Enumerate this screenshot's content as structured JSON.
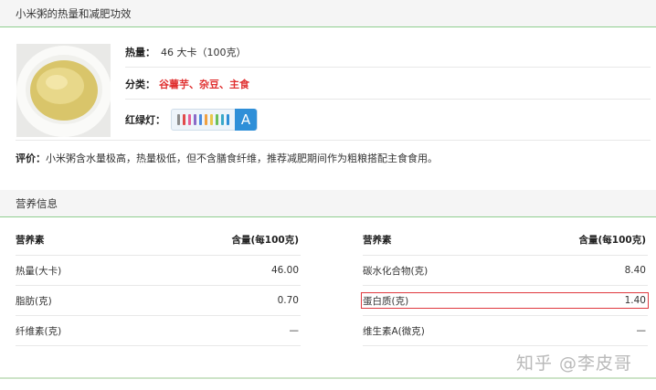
{
  "section1": {
    "title": "小米粥的热量和减肥功效"
  },
  "food": {
    "calories_label": "热量：",
    "calories_value": "46 大卡（100克）",
    "category_label": "分类：",
    "category_value": "谷薯芋、杂豆、主食",
    "traffic_label": "红绿灯：",
    "grade": "A",
    "grade_color": "#2f8fd8",
    "bar_colors": [
      "#8c8c8c",
      "#e14b4b",
      "#e85f9a",
      "#8a6ac8",
      "#4a8ce0",
      "#f0a040",
      "#e8c84a",
      "#6bbf59",
      "#3aa8c8",
      "#2f8fd8"
    ],
    "evaluation_label": "评价：",
    "evaluation_text": "小米粥含水量极高，热量极低，但不含膳食纤维，推荐减肥期间作为粗粮搭配主食食用。"
  },
  "section2": {
    "title": "营养信息"
  },
  "nutrition": {
    "header_nutrient": "营养素",
    "header_amount": "含量(每100克)",
    "left": [
      {
        "name": "热量(大卡)",
        "value": "46.00"
      },
      {
        "name": "脂肪(克)",
        "value": "0.70"
      },
      {
        "name": "纤维素(克)",
        "value": "—"
      }
    ],
    "right": [
      {
        "name": "碳水化合物(克)",
        "value": "8.40"
      },
      {
        "name": "蛋白质(克)",
        "value": "1.40"
      },
      {
        "name": "维生素A(微克)",
        "value": "—"
      }
    ]
  },
  "watermark": "知乎 @李皮哥"
}
